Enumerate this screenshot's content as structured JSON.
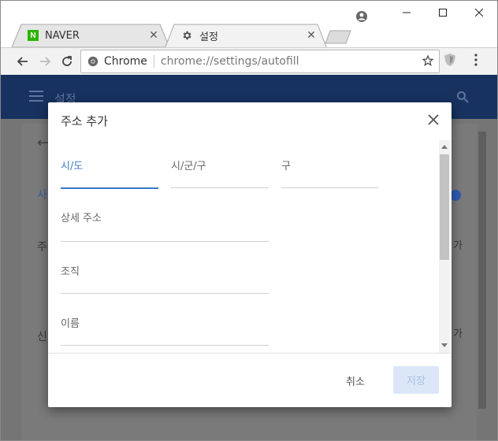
{
  "tabs": [
    {
      "title": "NAVER",
      "favicon": "naver-icon",
      "favicon_letter": "N"
    },
    {
      "title": "설정",
      "favicon": "gear-icon"
    }
  ],
  "toolbar": {
    "omnibox_label": "Chrome",
    "url": "chrome://settings/autofill"
  },
  "settings": {
    "title": "설정",
    "bg_labels": {
      "blue": "사",
      "text1": "주",
      "text2": "신",
      "suffix1": "가",
      "suffix2": "가"
    }
  },
  "dialog": {
    "title": "주소 추가",
    "fields": {
      "city": "시/도",
      "district": "시/군/구",
      "gu": "구",
      "address_detail": "상세 주소",
      "organization": "조직",
      "name": "이름"
    },
    "cancel_label": "취소",
    "save_label": "저장"
  },
  "colors": {
    "header_blue": "#17325f",
    "accent_blue": "#3b78c6",
    "save_disabled_bg": "#dbe7f7"
  }
}
